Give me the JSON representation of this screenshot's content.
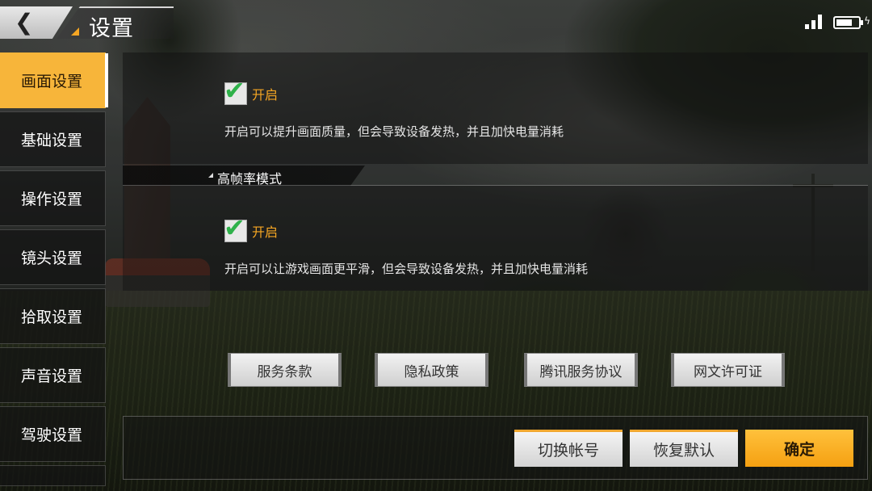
{
  "header": {
    "back_icon": "chevron-left-icon",
    "title": "设置"
  },
  "status_bar": {
    "signal_icon": "signal-icon",
    "battery_icon": "battery-charging-icon",
    "battery_level": 0.85
  },
  "sidebar": {
    "items": [
      {
        "label": "画面设置",
        "active": true
      },
      {
        "label": "基础设置",
        "active": false
      },
      {
        "label": "操作设置",
        "active": false
      },
      {
        "label": "镜头设置",
        "active": false
      },
      {
        "label": "拾取设置",
        "active": false
      },
      {
        "label": "声音设置",
        "active": false
      },
      {
        "label": "驾驶设置",
        "active": false
      }
    ]
  },
  "settings": {
    "hd_quality": {
      "checkbox_label": "开启",
      "checked": true,
      "description": "开启可以提升画面质量，但会导致设备发热，并且加快电量消耗"
    },
    "high_fps": {
      "section_title": "高帧率模式",
      "checkbox_label": "开启",
      "checked": true,
      "description": "开启可以让游戏画面更平滑，但会导致设备发热，并且加快电量消耗"
    }
  },
  "links": {
    "terms": "服务条款",
    "privacy": "隐私政策",
    "tencent_agreement": "腾讯服务协议",
    "license": "网文许可证"
  },
  "footer": {
    "switch_account": "切换帐号",
    "restore_default": "恢复默认",
    "confirm": "确定"
  },
  "colors": {
    "accent": "#f7b53a",
    "check_green": "#2fb14a",
    "label_orange": "#f5a623"
  }
}
